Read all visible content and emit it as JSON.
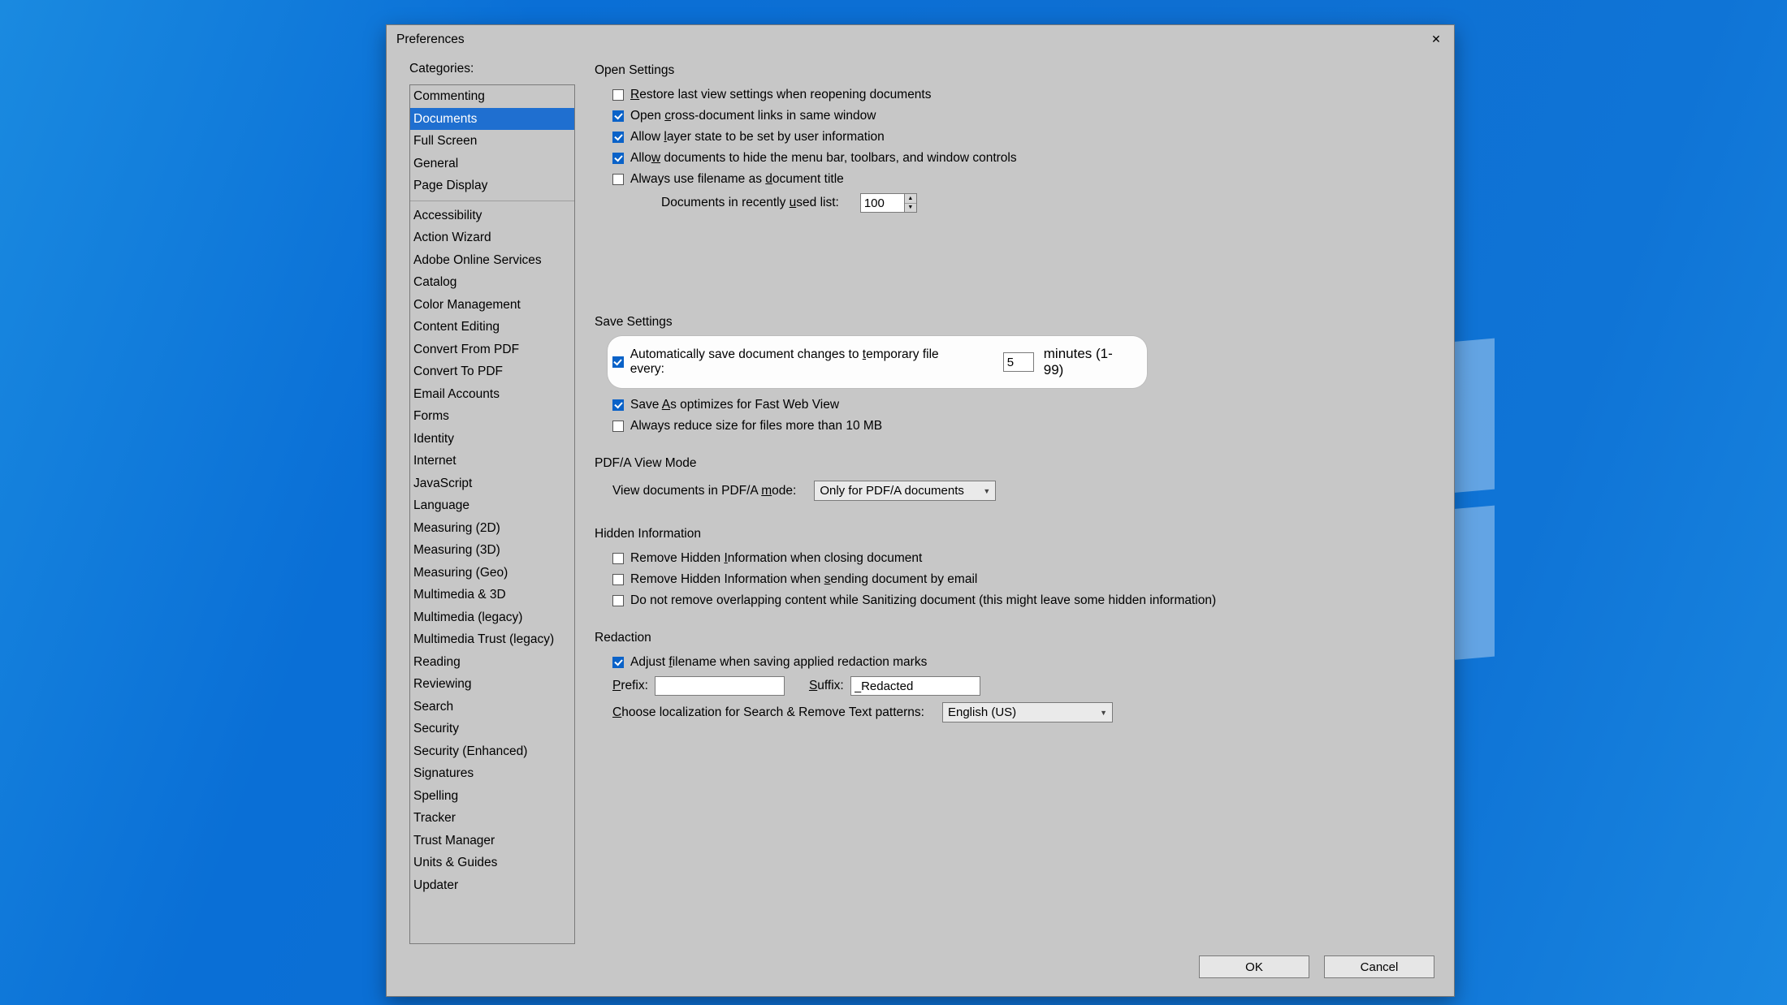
{
  "window": {
    "title": "Preferences"
  },
  "sidebar": {
    "title": "Categories:",
    "group1": [
      "Commenting",
      "Documents",
      "Full Screen",
      "General",
      "Page Display"
    ],
    "group2": [
      "Accessibility",
      "Action Wizard",
      "Adobe Online Services",
      "Catalog",
      "Color Management",
      "Content Editing",
      "Convert From PDF",
      "Convert To PDF",
      "Email Accounts",
      "Forms",
      "Identity",
      "Internet",
      "JavaScript",
      "Language",
      "Measuring (2D)",
      "Measuring (3D)",
      "Measuring (Geo)",
      "Multimedia & 3D",
      "Multimedia (legacy)",
      "Multimedia Trust (legacy)",
      "Reading",
      "Reviewing",
      "Search",
      "Security",
      "Security (Enhanced)",
      "Signatures",
      "Spelling",
      "Tracker",
      "Trust Manager",
      "Units & Guides",
      "Updater"
    ],
    "selected": "Documents"
  },
  "open": {
    "title": "Open Settings",
    "restore": {
      "checked": false,
      "pre": "",
      "u": "R",
      "post": "estore last view settings when reopening documents"
    },
    "cross": {
      "checked": true,
      "pre": "Open ",
      "u": "c",
      "post": "ross-document links in same window"
    },
    "layer": {
      "checked": true,
      "pre": "Allow ",
      "u": "l",
      "post": "ayer state to be set by user information"
    },
    "hidebars": {
      "checked": true,
      "pre": "Allo",
      "u": "w",
      "post": " documents to hide the menu bar, toolbars, and window controls"
    },
    "filename": {
      "checked": false,
      "pre": "Always use filename as ",
      "u": "d",
      "post": "ocument title"
    },
    "recent": {
      "pre": "Documents in recently ",
      "u": "u",
      "post": "sed list:",
      "value": "100"
    }
  },
  "save": {
    "title": "Save Settings",
    "autosave": {
      "checked": true,
      "pre": "Automatically save document changes to ",
      "u": "t",
      "post": "emporary file every:",
      "value": "5",
      "suffix": "minutes (1-99)"
    },
    "fastweb": {
      "checked": true,
      "pre": "Save ",
      "u": "A",
      "post": "s optimizes for Fast Web View"
    },
    "reduce": {
      "checked": false,
      "label": "Always reduce size for files more than 10 MB"
    }
  },
  "pdfa": {
    "title": "PDF/A View Mode",
    "label": {
      "pre": "View documents in PDF/A ",
      "u": "m",
      "post": "ode:"
    },
    "value": "Only for PDF/A documents"
  },
  "hidden": {
    "title": "Hidden Information",
    "close": {
      "checked": false,
      "pre": "Remove Hidden ",
      "u": "I",
      "post": "nformation when closing document"
    },
    "send": {
      "checked": false,
      "pre": "Remove Hidden Information when ",
      "u": "s",
      "post": "ending document by email"
    },
    "overlap": {
      "checked": false,
      "label": "Do not remove overlapping content while Sanitizing document (this might leave some hidden information)"
    }
  },
  "redaction": {
    "title": "Redaction",
    "adjust": {
      "checked": true,
      "pre": "Adjust ",
      "u": "f",
      "post": "ilename when saving applied redaction marks"
    },
    "prefix": {
      "u": "P",
      "post": "refix:",
      "value": ""
    },
    "suffix": {
      "u": "S",
      "post": "uffix:",
      "value": "_Redacted"
    },
    "locale": {
      "u": "C",
      "post": "hoose localization for Search & Remove Text patterns:",
      "value": "English (US)"
    }
  },
  "footer": {
    "ok": "OK",
    "cancel": "Cancel"
  }
}
